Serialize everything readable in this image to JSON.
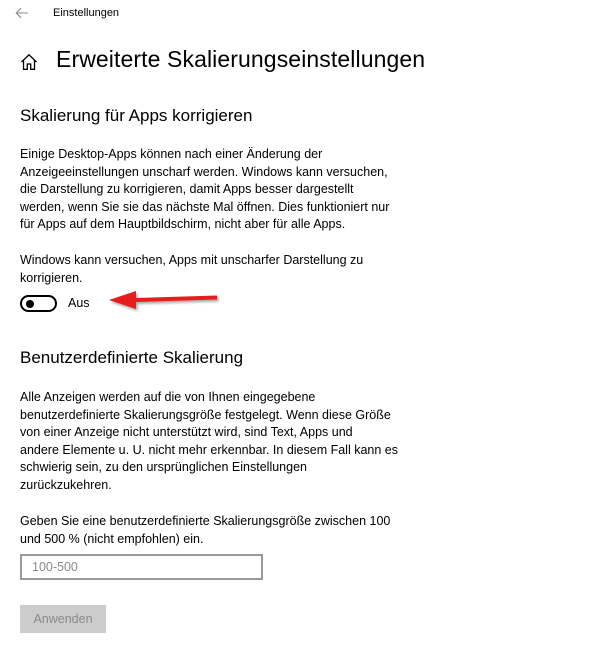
{
  "window": {
    "title": "Einstellungen",
    "back_icon": "arrow-left-icon"
  },
  "header": {
    "home_icon": "home-icon",
    "title": "Erweiterte Skalierungseinstellungen"
  },
  "fix_apps": {
    "heading": "Skalierung für Apps korrigieren",
    "description_lines": [
      "Einige Desktop-Apps können nach einer Änderung der",
      "Anzeigeeinstellungen unscharf werden. Windows kann versuchen,",
      "die Darstellung zu korrigieren, damit Apps besser dargestellt",
      "werden, wenn Sie sie das nächste Mal öffnen. Dies funktioniert nur",
      "für Apps auf dem Hauptbildschirm, nicht aber für alle Apps."
    ],
    "toggle_description_lines": [
      "Windows kann versuchen, Apps mit unscharfer Darstellung zu",
      "korrigieren."
    ],
    "toggle_state": "Aus",
    "toggle_on": false,
    "annotation_arrow_color": "#e81c1c"
  },
  "custom_scaling": {
    "heading": "Benutzerdefinierte Skalierung",
    "description_lines": [
      "Alle Anzeigen werden auf die von Ihnen eingegebene",
      "benutzerdefinierte Skalierungsgröße festgelegt. Wenn diese Größe",
      "von einer Anzeige nicht unterstützt wird, sind Text, Apps und",
      "andere Elemente u. U. nicht mehr erkennbar. In diesem Fall kann es",
      "schwierig sein, zu den ursprünglichen Einstellungen",
      "zurückzukehren."
    ],
    "input_label_lines": [
      "Geben Sie eine benutzerdefinierte Skalierungsgröße zwischen 100",
      "und 500 % (nicht empfohlen) ein."
    ],
    "input_placeholder": "100-500",
    "input_value": "",
    "apply_label": "Anwenden",
    "apply_enabled": false
  }
}
